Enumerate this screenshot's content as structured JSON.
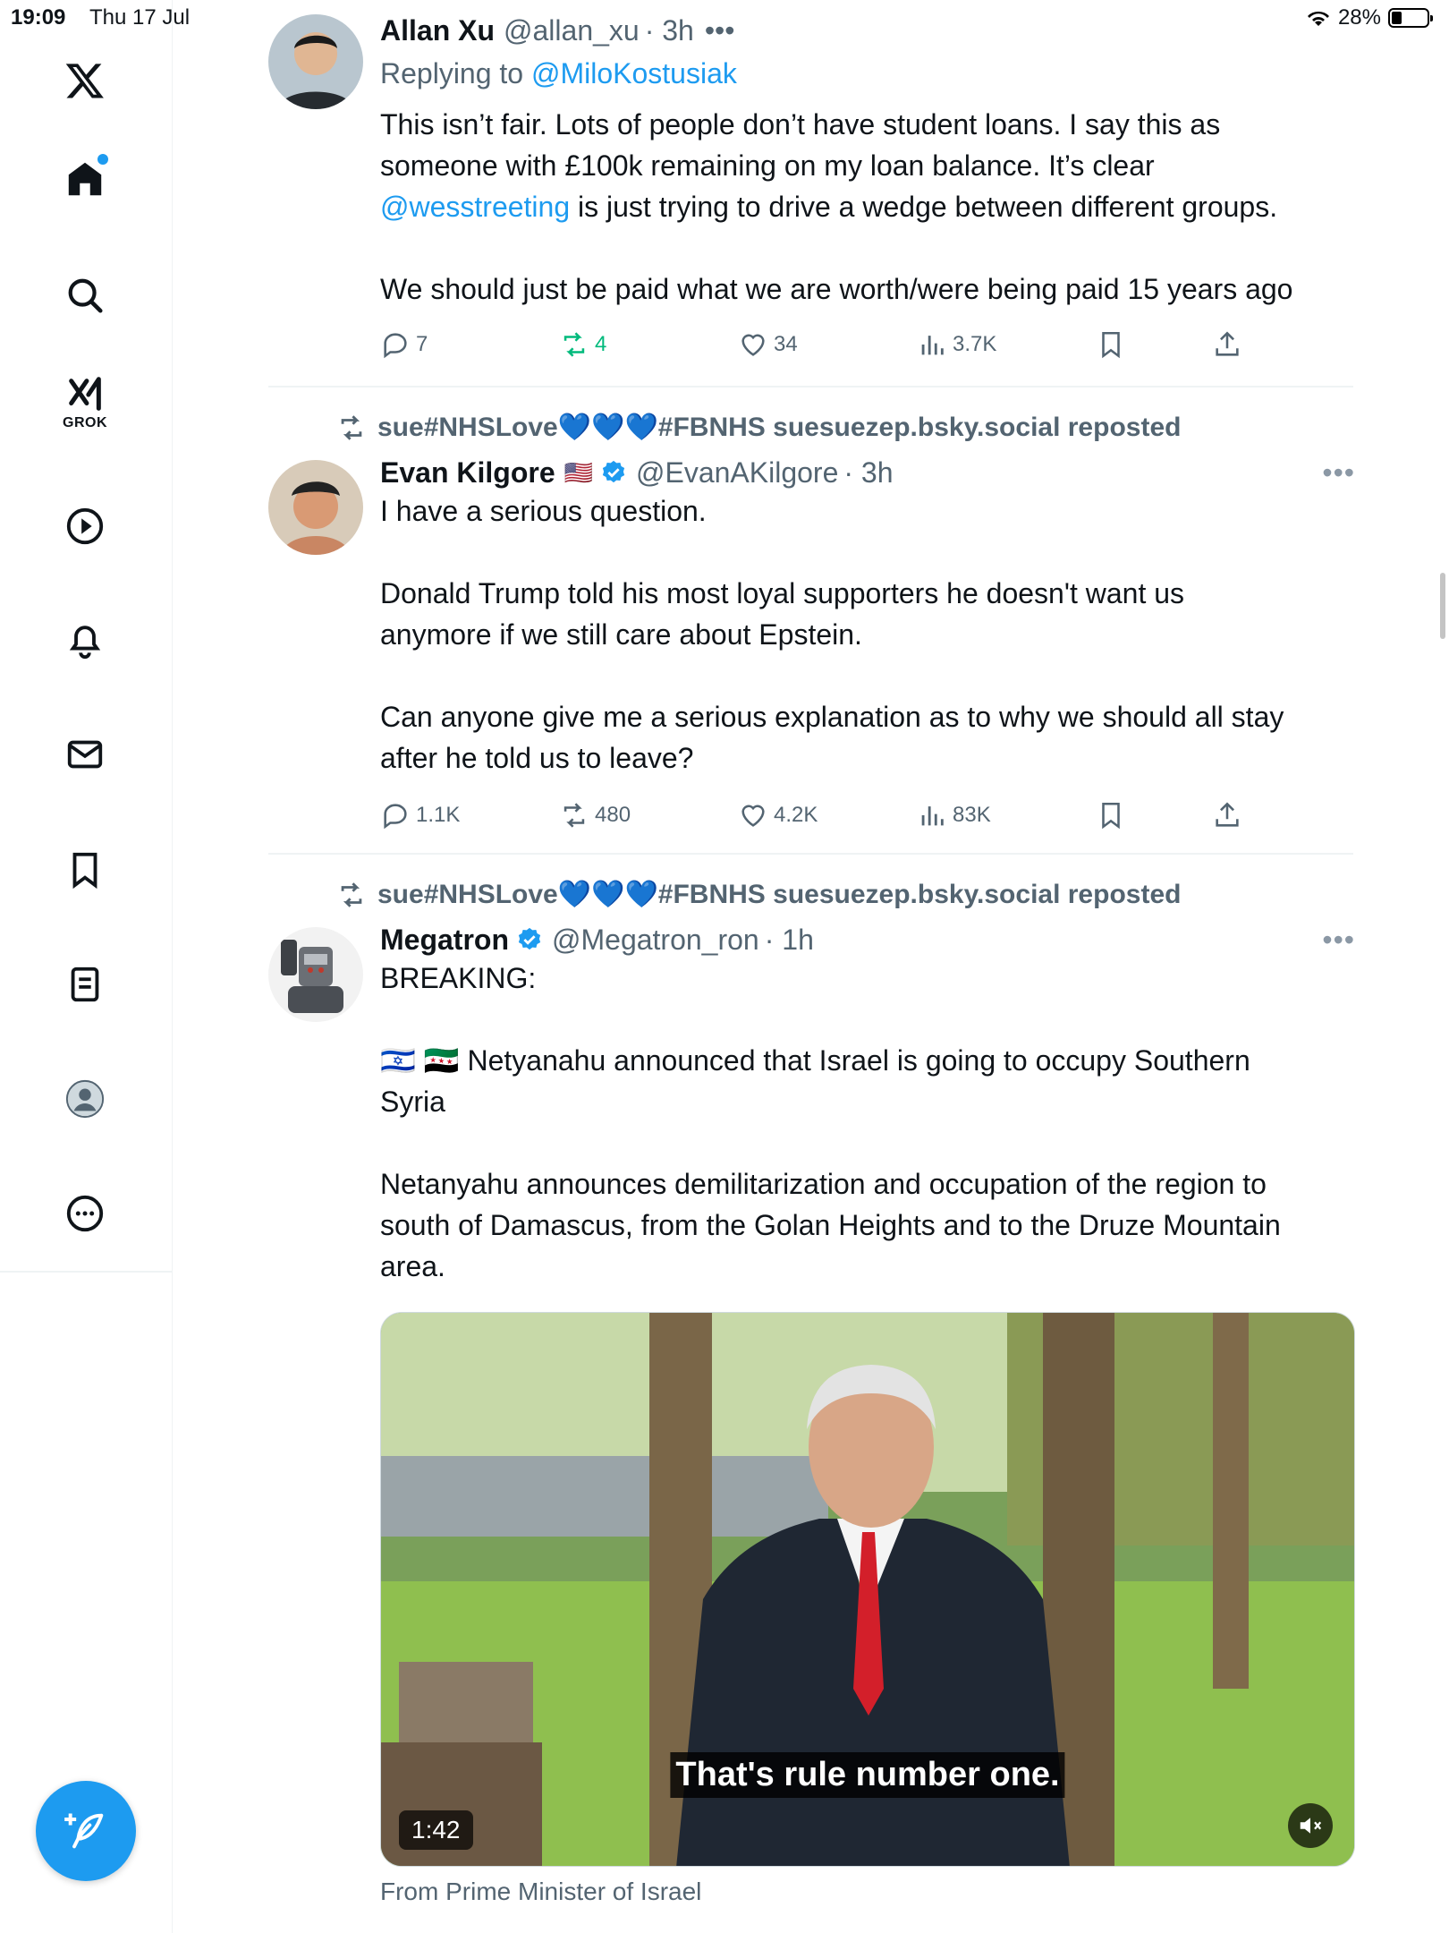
{
  "status_bar": {
    "time": "19:09",
    "date": "Thu 17 Jul",
    "battery": "28%",
    "battery_level": 0.28
  },
  "sidebar": {
    "items": [
      {
        "name": "home",
        "label": "Home"
      },
      {
        "name": "explore",
        "label": "Explore"
      },
      {
        "name": "grok",
        "label": "GROK"
      },
      {
        "name": "video",
        "label": "Video"
      },
      {
        "name": "notifications",
        "label": "Notifications"
      },
      {
        "name": "messages",
        "label": "Messages"
      },
      {
        "name": "bookmarks",
        "label": "Bookmarks"
      },
      {
        "name": "lists",
        "label": "Lists"
      },
      {
        "name": "profile",
        "label": "Profile"
      },
      {
        "name": "more",
        "label": "More"
      }
    ]
  },
  "tweets": [
    {
      "name": "Allan Xu",
      "handle": "@allan_xu",
      "time": "· 3h",
      "replying_prefix": "Replying to",
      "replying_to": "@MiloKostusiak",
      "text_1": "This isn’t fair. Lots of people don’t have student loans. I say this as\nsomeone with £100k remaining on my loan balance. It’s clear\n",
      "mention": "@wesstreeting",
      "text_2": " is just trying to drive a wedge between different groups.\n\nWe should just be paid what we are worth/were being paid 15 years ago",
      "replies": "7",
      "reposts": "4",
      "likes": "34",
      "views": "3.7K"
    },
    {
      "repost_by": "sue#NHSLove💙💙💙#FBNHS suesuezep.bsky.social reposted",
      "name": "Evan Kilgore",
      "flag": "🇺🇸",
      "handle": "@EvanAKilgore",
      "time": "· 3h",
      "text": "I have a serious question.\n\nDonald Trump told his most loyal supporters he doesn't want us\nanymore if we still care about Epstein.\n\nCan anyone give me a serious explanation as to why we should all stay\nafter he told us to leave?",
      "replies": "1.1K",
      "reposts": "480",
      "likes": "4.2K",
      "views": "83K"
    },
    {
      "repost_by": "sue#NHSLove💙💙💙#FBNHS suesuezep.bsky.social reposted",
      "name": "Megatron",
      "handle": "@Megatron_ron",
      "time": "· 1h",
      "text": "BREAKING:\n\n🇮🇱 🇸🇾 Netyanahu announced that Israel is going to occupy Southern\nSyria\n\nNetanyahu announces demilitarization and occupation of the region to\nsouth of Damascus, from the Golan Heights and to the Druze Mountain\narea.",
      "video_caption": "That's rule number one.",
      "video_duration": "1:42",
      "source": "From Prime Minister of Israel"
    }
  ],
  "more_dots": "•••",
  "colors": {
    "accent": "#1d9bf0",
    "repost_green": "#00ba7c",
    "secondary_text": "#536471"
  }
}
